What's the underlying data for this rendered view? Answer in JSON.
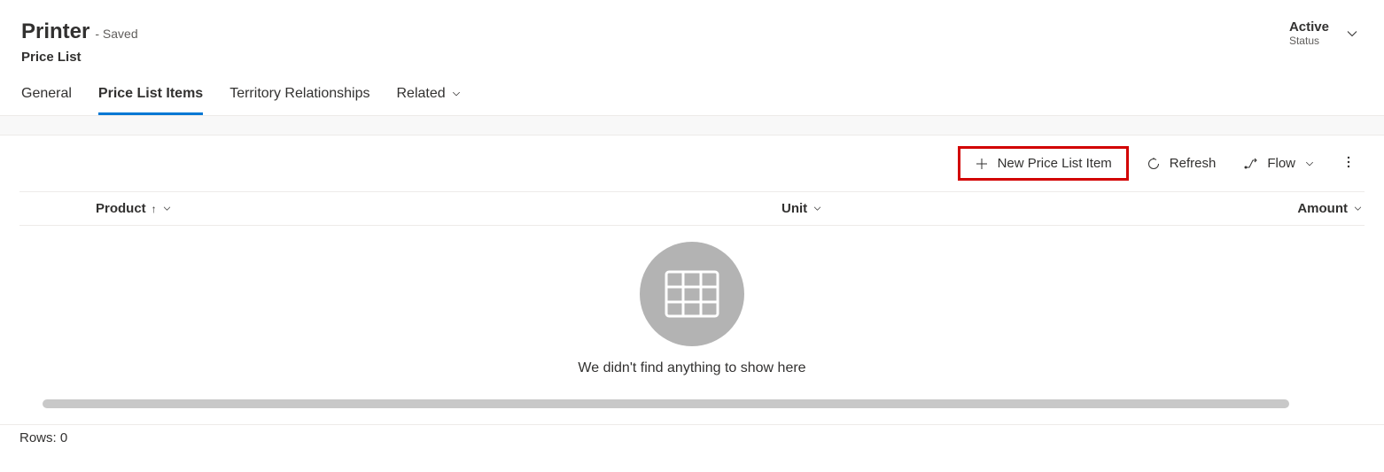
{
  "header": {
    "title": "Printer",
    "saved_indicator": "- Saved",
    "entity_type": "Price List",
    "status_value": "Active",
    "status_label": "Status"
  },
  "tabs": {
    "general": "General",
    "price_list_items": "Price List Items",
    "territory_relationships": "Territory Relationships",
    "related": "Related"
  },
  "toolbar": {
    "new_item_label": "New Price List Item",
    "refresh_label": "Refresh",
    "flow_label": "Flow"
  },
  "columns": {
    "product": "Product",
    "unit": "Unit",
    "amount": "Amount"
  },
  "empty_state": {
    "message": "We didn't find anything to show here"
  },
  "footer": {
    "rows_label": "Rows: 0"
  }
}
